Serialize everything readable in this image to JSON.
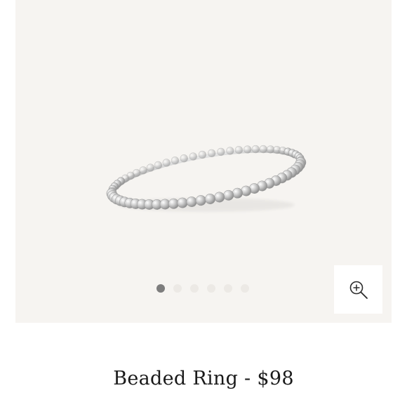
{
  "product": {
    "name": "Beaded Ring",
    "price": "$98",
    "title": "Beaded Ring - $98"
  },
  "gallery": {
    "image_count": 6,
    "active_index": 0,
    "zoom_icon": "zoom-in-icon"
  },
  "colors": {
    "gallery_background": "#f6f4f1",
    "active_dot": "#7d7d7d",
    "inactive_dot": "#ece9e5",
    "ring_metal": "#b9b9b9"
  }
}
